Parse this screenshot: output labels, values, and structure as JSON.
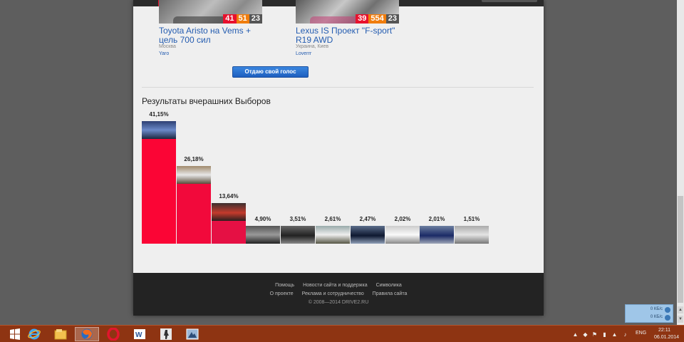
{
  "candidates": [
    {
      "title": "Toyota Aristo на Vems + цель 700 сил",
      "location": "Москва",
      "user": "Yaro",
      "scores": [
        "41",
        "51",
        "23"
      ]
    },
    {
      "title": "Lexus IS Проект \"F-sport\" R19 AWD",
      "location": "Украина, Киев",
      "user": "Loverrr",
      "scores": [
        "39",
        "554",
        "23"
      ]
    }
  ],
  "vote_button": "Отдаю свой голос",
  "results_title": "Результаты вчерашних Выборов",
  "chart_data": {
    "type": "bar",
    "categories": [
      "41,15%",
      "26,18%",
      "13,64%",
      "4,90%",
      "3,51%",
      "2,61%",
      "2,47%",
      "2,02%",
      "2,01%",
      "1,51%"
    ],
    "values": [
      41.15,
      26.18,
      13.64,
      4.9,
      3.51,
      2.61,
      2.47,
      2.02,
      2.01,
      1.51
    ],
    "colors": [
      "#fb0535",
      "#f2093b",
      "#e51044",
      "#d8184f",
      "#cd1f59",
      "#bf2a64",
      "#b0356f",
      "#a63e7b",
      "#9a4886",
      "#8e5090"
    ],
    "ylim": [
      0,
      41.15
    ]
  },
  "footer": {
    "row1": [
      "Помощь",
      "Новости сайта и поддержка",
      "Символика"
    ],
    "row2": [
      "О проекте",
      "Реклама и сотрудничество",
      "Правила сайта"
    ],
    "copyright": "© 2008—2014 DRIVE2.RU"
  },
  "net_widget": {
    "up": "0 КБ/с",
    "down": "0 КБ/с"
  },
  "tray": {
    "lang": "ENG",
    "time": "22:11",
    "date": "06.01.2014"
  },
  "taskbar_apps": [
    "ie-icon",
    "explorer-icon",
    "firefox-icon",
    "opera-icon",
    "word-icon",
    "counter-strike-icon",
    "app-icon"
  ]
}
